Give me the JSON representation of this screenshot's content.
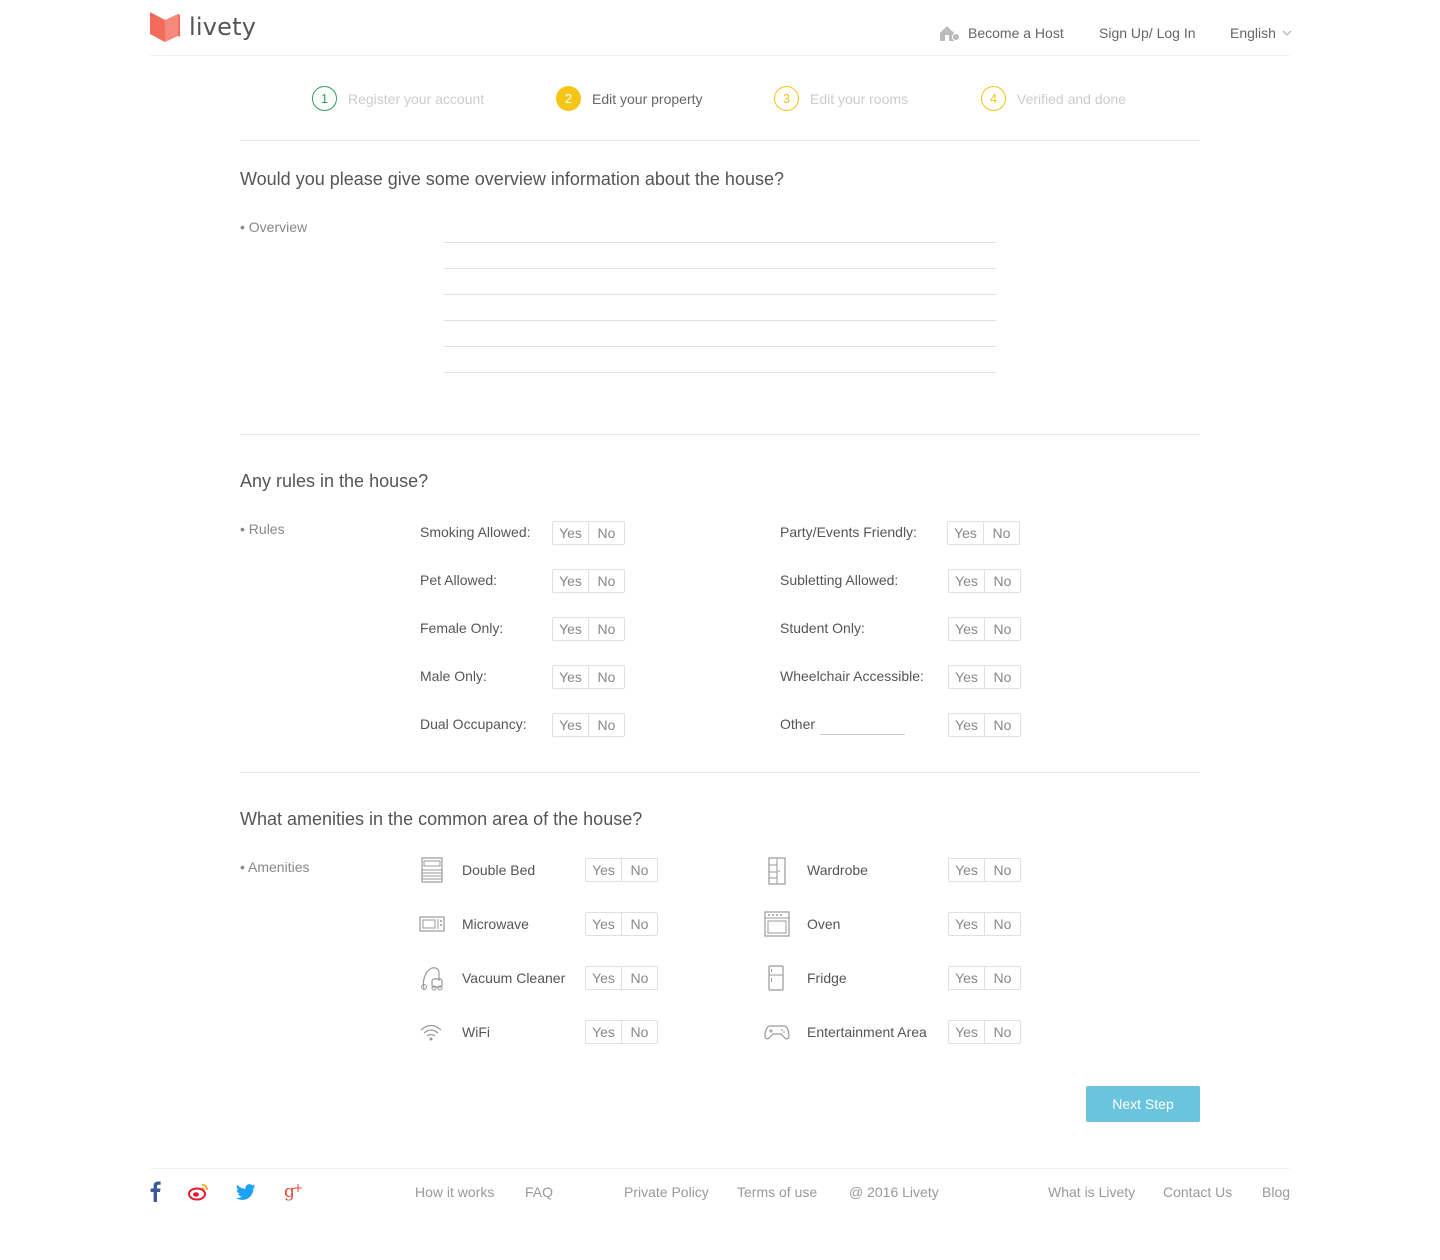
{
  "header": {
    "logo_text": "livety",
    "become_host": "Become a Host",
    "login": "Sign Up/ Log In",
    "language": "English"
  },
  "steps": [
    {
      "num": "1",
      "label": "Register your account"
    },
    {
      "num": "2",
      "label": "Edit your property"
    },
    {
      "num": "3",
      "label": "Edit your rooms"
    },
    {
      "num": "4",
      "label": "Verified and done"
    }
  ],
  "overview": {
    "title": "Would you please give some overview information about the house?",
    "label": "• Overview"
  },
  "rules": {
    "title": "Any rules in the house?",
    "label": "• Rules",
    "left": [
      "Smoking Allowed:",
      "Pet Allowed:",
      "Female Only:",
      "Male Only:",
      "Dual Occupancy:"
    ],
    "right": [
      "Party/Events Friendly:",
      "Subletting Allowed:",
      "Student Only:",
      "Wheelchair Accessible:",
      "Other"
    ]
  },
  "amenities": {
    "title": "What amenities in the common area of the house?",
    "label": "• Amenities",
    "left": [
      {
        "label": "Double Bed",
        "icon": "bed-icon"
      },
      {
        "label": "Microwave",
        "icon": "microwave-icon"
      },
      {
        "label": "Vacuum Cleaner",
        "icon": "vacuum-icon"
      },
      {
        "label": "WiFi",
        "icon": "wifi-icon"
      }
    ],
    "right": [
      {
        "label": "Wardrobe",
        "icon": "wardrobe-icon"
      },
      {
        "label": "Oven",
        "icon": "oven-icon"
      },
      {
        "label": "Fridge",
        "icon": "fridge-icon"
      },
      {
        "label": "Entertainment Area",
        "icon": "gamepad-icon"
      }
    ]
  },
  "toggle": {
    "yes": "Yes",
    "no": "No"
  },
  "next_step": "Next Step",
  "footer": {
    "how": "How it works",
    "faq": "FAQ",
    "privacy": "Private Policy",
    "terms": "Terms of use",
    "copyright": "@ 2016 Livety",
    "what": "What is Livety",
    "contact": "Contact Us",
    "blog": "Blog"
  },
  "colors": {
    "brand": "#f26b5b",
    "step_done": "#2ca05a",
    "step_active": "#f5c518",
    "button": "#6ac4dc",
    "facebook": "#3b5998",
    "weibo": "#e6162d",
    "twitter": "#1da1f2",
    "gplus": "#dd4b39"
  }
}
